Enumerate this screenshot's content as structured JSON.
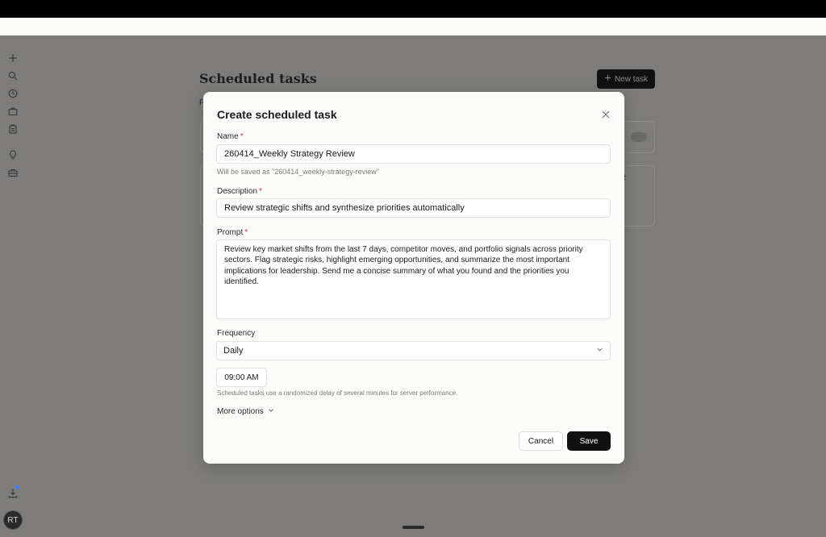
{
  "background": {
    "page_title": "Scheduled tasks",
    "subtitle_fragment": "F",
    "new_task_label": "New task",
    "card_number_fragment": "2",
    "avatar_initials": "RT"
  },
  "modal": {
    "title": "Create scheduled task",
    "name": {
      "label": "Name",
      "required_mark": "*",
      "value": "260414_Weekly Strategy Review",
      "hint": "Will be saved as \"260414_weekly-strategy-review\""
    },
    "description": {
      "label": "Description",
      "required_mark": "*",
      "value": "Review strategic shifts and synthesize priorities automatically"
    },
    "prompt": {
      "label": "Prompt",
      "required_mark": "*",
      "value": "Review key market shifts from the last 7 days, competitor moves, and portfolio signals across priority sectors. Flag strategic risks, highlight emerging opportunities, and summarize the most important implications for leadership. Send me a concise summary of what you found and the priorities you identified."
    },
    "frequency": {
      "label": "Frequency",
      "selected": "Daily"
    },
    "time": {
      "value": "09:00 AM",
      "hint": "Scheduled tasks use a randomized delay of several minutes for server performance."
    },
    "more_options_label": "More options",
    "cancel_label": "Cancel",
    "save_label": "Save"
  },
  "colors": {
    "overlay": "#7d7c7a",
    "modal_bg": "#fbfbfa",
    "primary_button": "#111111",
    "required": "#d93030",
    "notification_dot": "#3b82f6"
  },
  "icons": [
    "plus-icon",
    "search-icon",
    "clock-icon",
    "briefcase-icon",
    "clipboard-icon",
    "lightbulb-icon",
    "toolbox-icon",
    "download-icon",
    "close-icon",
    "chevron-down-icon"
  ]
}
